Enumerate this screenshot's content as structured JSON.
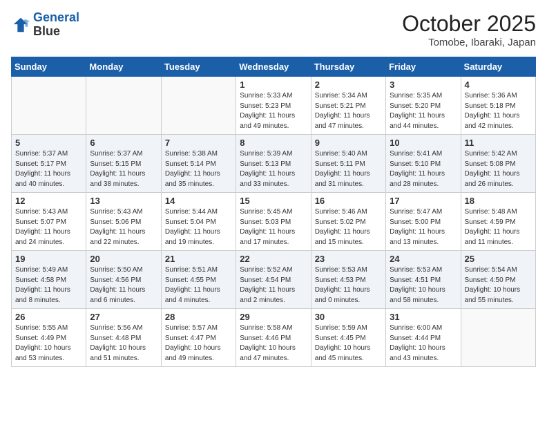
{
  "logo": {
    "line1": "General",
    "line2": "Blue"
  },
  "title": "October 2025",
  "location": "Tomobe, Ibaraki, Japan",
  "weekdays": [
    "Sunday",
    "Monday",
    "Tuesday",
    "Wednesday",
    "Thursday",
    "Friday",
    "Saturday"
  ],
  "weeks": [
    [
      {
        "day": "",
        "info": ""
      },
      {
        "day": "",
        "info": ""
      },
      {
        "day": "",
        "info": ""
      },
      {
        "day": "1",
        "info": "Sunrise: 5:33 AM\nSunset: 5:23 PM\nDaylight: 11 hours\nand 49 minutes."
      },
      {
        "day": "2",
        "info": "Sunrise: 5:34 AM\nSunset: 5:21 PM\nDaylight: 11 hours\nand 47 minutes."
      },
      {
        "day": "3",
        "info": "Sunrise: 5:35 AM\nSunset: 5:20 PM\nDaylight: 11 hours\nand 44 minutes."
      },
      {
        "day": "4",
        "info": "Sunrise: 5:36 AM\nSunset: 5:18 PM\nDaylight: 11 hours\nand 42 minutes."
      }
    ],
    [
      {
        "day": "5",
        "info": "Sunrise: 5:37 AM\nSunset: 5:17 PM\nDaylight: 11 hours\nand 40 minutes."
      },
      {
        "day": "6",
        "info": "Sunrise: 5:37 AM\nSunset: 5:15 PM\nDaylight: 11 hours\nand 38 minutes."
      },
      {
        "day": "7",
        "info": "Sunrise: 5:38 AM\nSunset: 5:14 PM\nDaylight: 11 hours\nand 35 minutes."
      },
      {
        "day": "8",
        "info": "Sunrise: 5:39 AM\nSunset: 5:13 PM\nDaylight: 11 hours\nand 33 minutes."
      },
      {
        "day": "9",
        "info": "Sunrise: 5:40 AM\nSunset: 5:11 PM\nDaylight: 11 hours\nand 31 minutes."
      },
      {
        "day": "10",
        "info": "Sunrise: 5:41 AM\nSunset: 5:10 PM\nDaylight: 11 hours\nand 28 minutes."
      },
      {
        "day": "11",
        "info": "Sunrise: 5:42 AM\nSunset: 5:08 PM\nDaylight: 11 hours\nand 26 minutes."
      }
    ],
    [
      {
        "day": "12",
        "info": "Sunrise: 5:43 AM\nSunset: 5:07 PM\nDaylight: 11 hours\nand 24 minutes."
      },
      {
        "day": "13",
        "info": "Sunrise: 5:43 AM\nSunset: 5:06 PM\nDaylight: 11 hours\nand 22 minutes."
      },
      {
        "day": "14",
        "info": "Sunrise: 5:44 AM\nSunset: 5:04 PM\nDaylight: 11 hours\nand 19 minutes."
      },
      {
        "day": "15",
        "info": "Sunrise: 5:45 AM\nSunset: 5:03 PM\nDaylight: 11 hours\nand 17 minutes."
      },
      {
        "day": "16",
        "info": "Sunrise: 5:46 AM\nSunset: 5:02 PM\nDaylight: 11 hours\nand 15 minutes."
      },
      {
        "day": "17",
        "info": "Sunrise: 5:47 AM\nSunset: 5:00 PM\nDaylight: 11 hours\nand 13 minutes."
      },
      {
        "day": "18",
        "info": "Sunrise: 5:48 AM\nSunset: 4:59 PM\nDaylight: 11 hours\nand 11 minutes."
      }
    ],
    [
      {
        "day": "19",
        "info": "Sunrise: 5:49 AM\nSunset: 4:58 PM\nDaylight: 11 hours\nand 8 minutes."
      },
      {
        "day": "20",
        "info": "Sunrise: 5:50 AM\nSunset: 4:56 PM\nDaylight: 11 hours\nand 6 minutes."
      },
      {
        "day": "21",
        "info": "Sunrise: 5:51 AM\nSunset: 4:55 PM\nDaylight: 11 hours\nand 4 minutes."
      },
      {
        "day": "22",
        "info": "Sunrise: 5:52 AM\nSunset: 4:54 PM\nDaylight: 11 hours\nand 2 minutes."
      },
      {
        "day": "23",
        "info": "Sunrise: 5:53 AM\nSunset: 4:53 PM\nDaylight: 11 hours\nand 0 minutes."
      },
      {
        "day": "24",
        "info": "Sunrise: 5:53 AM\nSunset: 4:51 PM\nDaylight: 10 hours\nand 58 minutes."
      },
      {
        "day": "25",
        "info": "Sunrise: 5:54 AM\nSunset: 4:50 PM\nDaylight: 10 hours\nand 55 minutes."
      }
    ],
    [
      {
        "day": "26",
        "info": "Sunrise: 5:55 AM\nSunset: 4:49 PM\nDaylight: 10 hours\nand 53 minutes."
      },
      {
        "day": "27",
        "info": "Sunrise: 5:56 AM\nSunset: 4:48 PM\nDaylight: 10 hours\nand 51 minutes."
      },
      {
        "day": "28",
        "info": "Sunrise: 5:57 AM\nSunset: 4:47 PM\nDaylight: 10 hours\nand 49 minutes."
      },
      {
        "day": "29",
        "info": "Sunrise: 5:58 AM\nSunset: 4:46 PM\nDaylight: 10 hours\nand 47 minutes."
      },
      {
        "day": "30",
        "info": "Sunrise: 5:59 AM\nSunset: 4:45 PM\nDaylight: 10 hours\nand 45 minutes."
      },
      {
        "day": "31",
        "info": "Sunrise: 6:00 AM\nSunset: 4:44 PM\nDaylight: 10 hours\nand 43 minutes."
      },
      {
        "day": "",
        "info": ""
      }
    ]
  ]
}
